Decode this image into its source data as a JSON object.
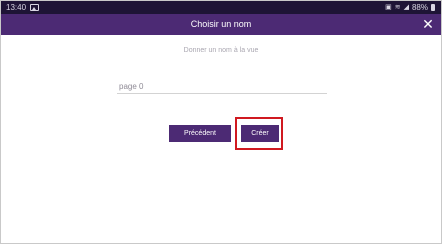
{
  "status_bar": {
    "time": "13:40",
    "battery_text": "88%"
  },
  "dialog": {
    "title": "Choisir un nom",
    "subtitle": "Donner un nom à la vue",
    "name_input": {
      "value": "page 0"
    },
    "buttons": {
      "previous_label": "Précédent",
      "create_label": "Créer"
    }
  },
  "colors": {
    "header": "#4c2a74",
    "status_bar": "#1e1436",
    "highlight": "#d01920"
  },
  "icons": {
    "close": "close-icon",
    "gallery": "image-icon",
    "battery": "battery-icon"
  }
}
